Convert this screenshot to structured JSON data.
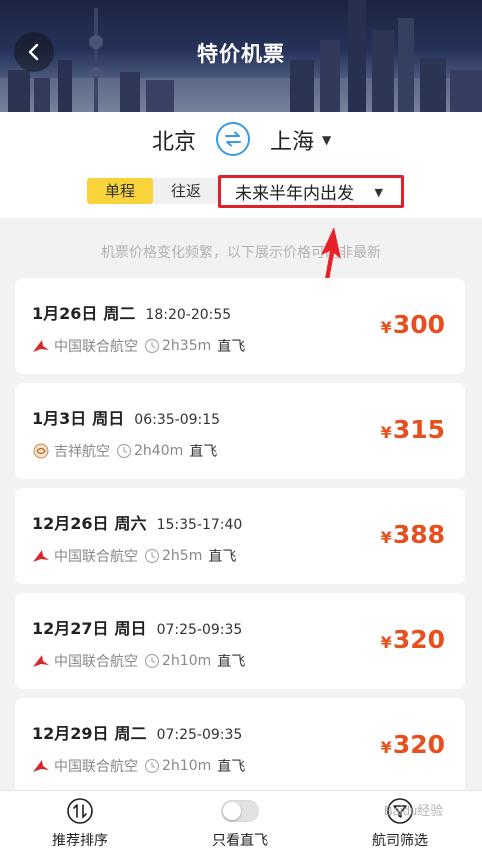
{
  "header": {
    "title": "特价机票",
    "back_icon": "chevron-left-icon"
  },
  "route": {
    "from_city": "北京",
    "to_city": "上海",
    "swap_icon": "swap-arrows-icon",
    "trip_types": [
      "单程",
      "往返"
    ],
    "active_trip_type": "单程",
    "date_range": "未来半年内出发"
  },
  "notice": "机票价格变化频繁，以下展示价格可能非最新",
  "currency_symbol": "¥",
  "flights": [
    {
      "date": "1月26日",
      "weekday": "周二",
      "time": "18:20-20:55",
      "airline": "中国联合航空",
      "airline_icon": "china-united-logo-icon",
      "duration": "2h35m",
      "type": "直飞",
      "price": "300"
    },
    {
      "date": "1月3日",
      "weekday": "周日",
      "time": "06:35-09:15",
      "airline": "吉祥航空",
      "airline_icon": "juneyao-logo-icon",
      "duration": "2h40m",
      "type": "直飞",
      "price": "315"
    },
    {
      "date": "12月26日",
      "weekday": "周六",
      "time": "15:35-17:40",
      "airline": "中国联合航空",
      "airline_icon": "china-united-logo-icon",
      "duration": "2h5m",
      "type": "直飞",
      "price": "388"
    },
    {
      "date": "12月27日",
      "weekday": "周日",
      "time": "07:25-09:35",
      "airline": "中国联合航空",
      "airline_icon": "china-united-logo-icon",
      "duration": "2h10m",
      "type": "直飞",
      "price": "320"
    },
    {
      "date": "12月29日",
      "weekday": "周二",
      "time": "07:25-09:35",
      "airline": "中国联合航空",
      "airline_icon": "china-united-logo-icon",
      "duration": "2h10m",
      "type": "直飞",
      "price": "320"
    }
  ],
  "bottom_bar": {
    "sort_label": "推荐排序",
    "direct_only_label": "只看直飞",
    "filter_label": "航司筛选"
  },
  "watermark": "Baidu经验",
  "colors": {
    "price": "#e6501e",
    "accent_yellow": "#f8d33a",
    "highlight_red": "#e0202a",
    "swap_blue": "#3a9be0"
  }
}
